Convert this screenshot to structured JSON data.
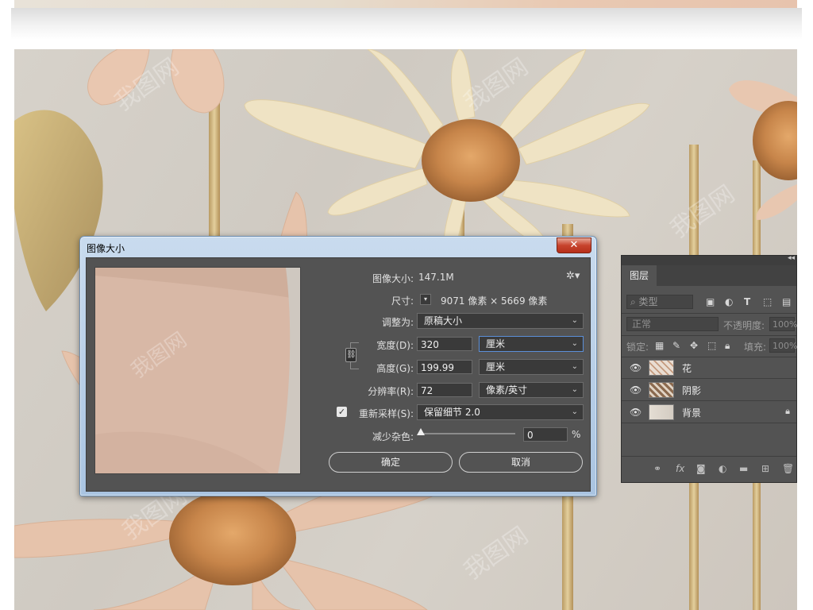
{
  "watermark": "我图网",
  "dialog": {
    "title": "图像大小",
    "close_label": "✕",
    "image_size_label": "图像大小:",
    "image_size_value": "147.1M",
    "gear_icon": "gear-icon",
    "dimensions_label": "尺寸:",
    "dimensions_value": "9071 像素  ×  5669 像素",
    "fit_to_label": "调整为:",
    "fit_to_value": "原稿大小",
    "width_label": "宽度(D):",
    "width_value": "320",
    "width_unit": "厘米",
    "height_label": "高度(G):",
    "height_value": "199.99",
    "height_unit": "厘米",
    "resolution_label": "分辨率(R):",
    "resolution_value": "72",
    "resolution_unit": "像素/英寸",
    "resample_label": "重新采样(S):",
    "resample_checked": true,
    "resample_value": "保留细节 2.0",
    "noise_label": "减少杂色:",
    "noise_value": "0",
    "noise_unit": "%",
    "ok_label": "确定",
    "cancel_label": "取消"
  },
  "layers_panel": {
    "tab_label": "图层",
    "filter_placeholder": "类型",
    "blend_mode": "正常",
    "opacity_label": "不透明度:",
    "opacity_value": "100%",
    "lock_label": "锁定:",
    "fill_label": "填充:",
    "fill_value": "100%",
    "layers": [
      {
        "name": "花",
        "visible": true,
        "locked": false
      },
      {
        "name": "阴影",
        "visible": true,
        "locked": false
      },
      {
        "name": "背景",
        "visible": true,
        "locked": true
      }
    ],
    "bottom_icons": [
      "link-icon",
      "fx-icon",
      "mask-icon",
      "adjustment-icon",
      "folder-icon",
      "new-layer-icon",
      "trash-icon"
    ]
  },
  "colors": {
    "dialog_bg": "#535353",
    "title_bar": "#a9c4e1",
    "close_red": "#c7432d",
    "accent_blue": "#5b8fd8",
    "petal_cream": "#efe0c0",
    "petal_peach": "#e5c0a8",
    "flower_center": "#c9894a"
  }
}
